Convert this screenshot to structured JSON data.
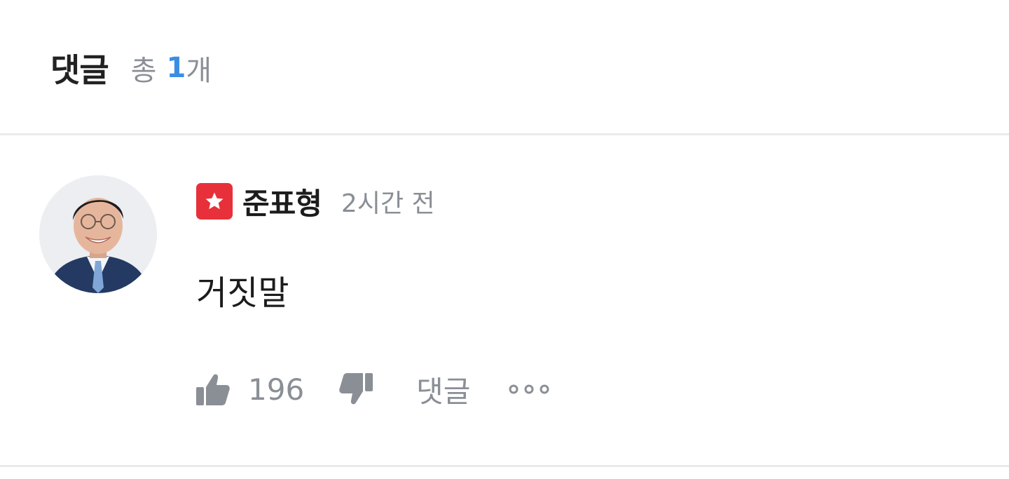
{
  "header": {
    "title": "댓글",
    "count_prefix": "총",
    "count": "1",
    "count_suffix": "개"
  },
  "comment": {
    "avatar_icon": "user-avatar",
    "badge_icon": "star-badge-icon",
    "badge_color": "#e8303a",
    "author": "준표형",
    "time": "2시간 전",
    "body": "거짓말",
    "like_icon": "thumbs-up-icon",
    "likes": "196",
    "dislike_icon": "thumbs-down-icon",
    "reply_label": "댓글",
    "more_icon": "more-dots-icon"
  },
  "colors": {
    "accent": "#3b8de4",
    "muted": "#8a8f96",
    "divider": "#e9eaec"
  }
}
